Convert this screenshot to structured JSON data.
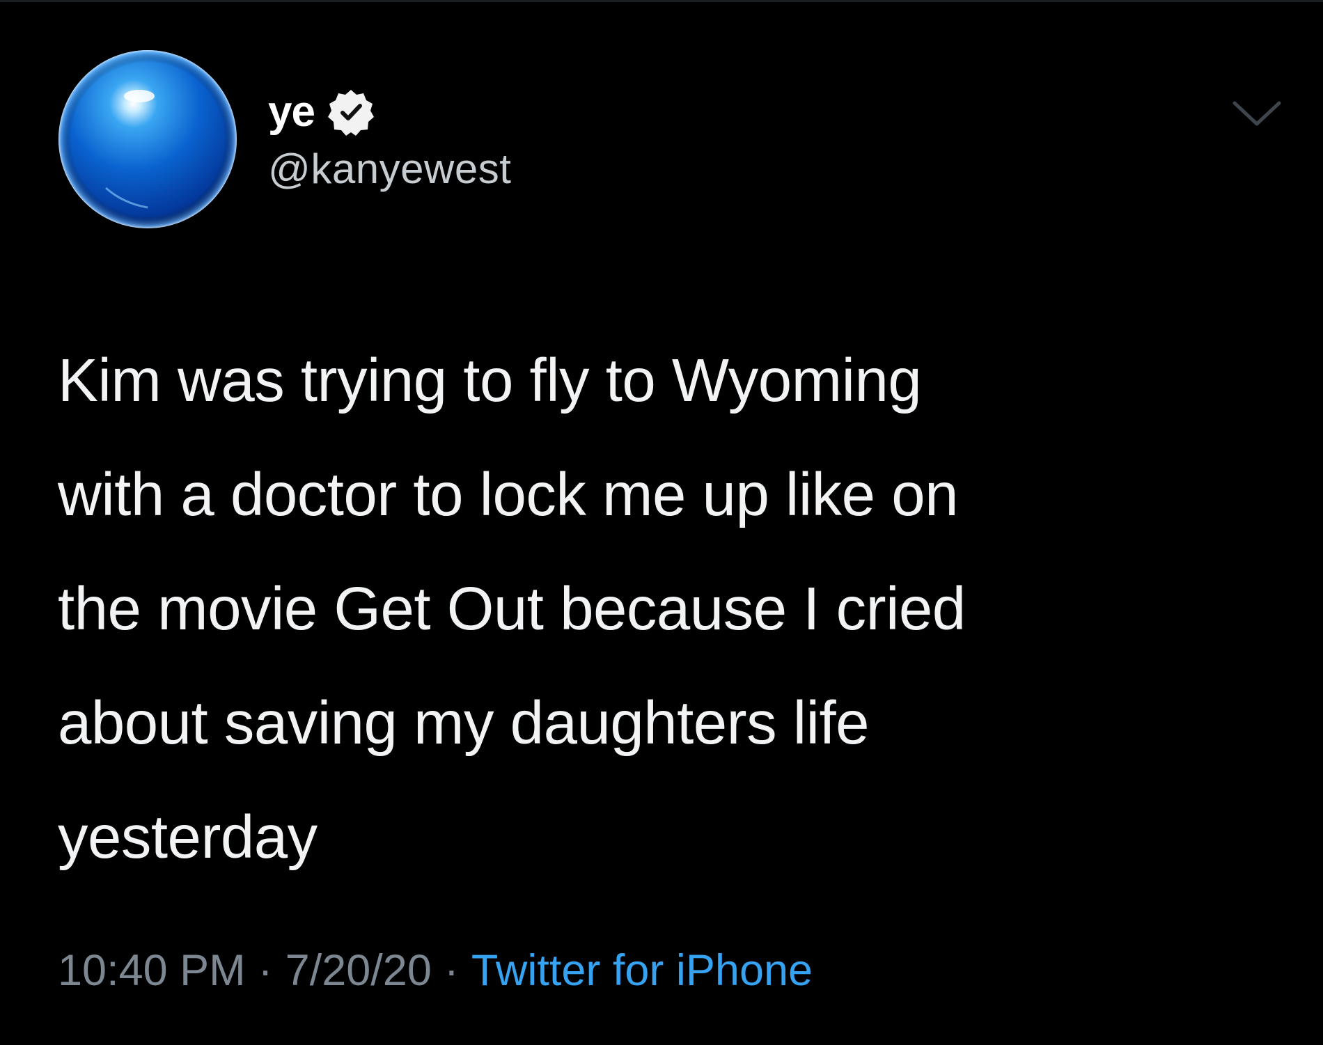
{
  "tweet": {
    "display_name": "ye",
    "verified_icon": "verified-badge-icon",
    "handle": "@kanyewest",
    "avatar_icon": "blue-orb-avatar",
    "more_icon": "chevron-down-icon",
    "text": "Kim was trying to fly to Wyoming\nwith a doctor to lock me up like on\nthe movie Get Out because I cried\nabout saving my daughters life\nyesterday",
    "time": "10:40 PM",
    "separator": "·",
    "date": "7/20/20",
    "source": "Twitter for iPhone"
  },
  "colors": {
    "background": "#000000",
    "text": "#f1f3f4",
    "muted": "#7c8791",
    "link": "#35a2f2"
  }
}
